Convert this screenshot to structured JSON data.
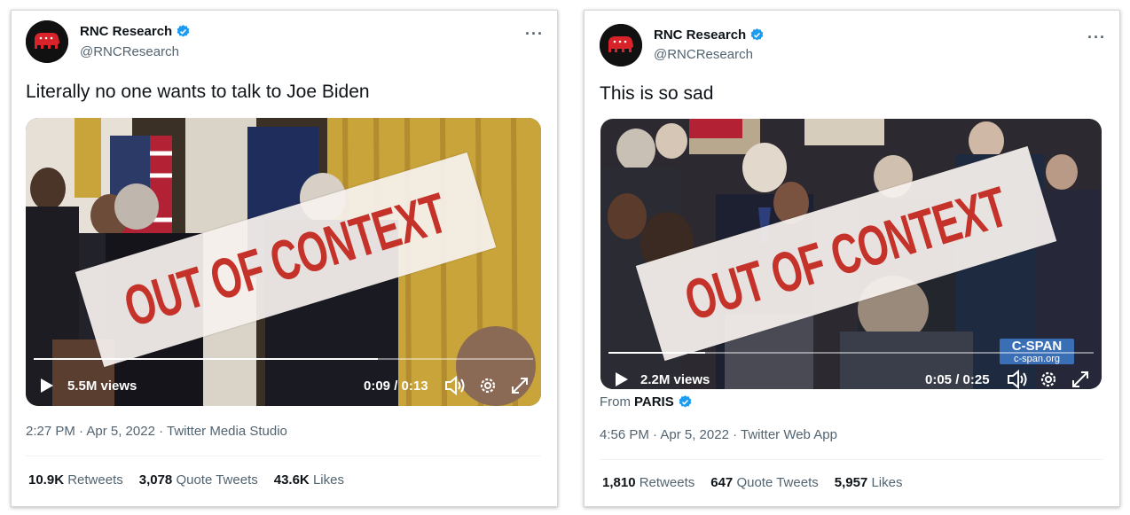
{
  "left": {
    "account": {
      "name": "RNC Research",
      "handle": "@RNCResearch"
    },
    "more_label": "···",
    "text": "Literally no one wants to talk to Joe Biden",
    "video": {
      "views": "5.5M views",
      "time": "0:09 / 0:13",
      "progress": 0.69
    },
    "overlay": "OUT OF CONTEXT",
    "meta": "2:27 PM · Apr 5, 2022 · Twitter Media Studio",
    "stats": {
      "retweets_count": "10.9K",
      "retweets_label": "Retweets",
      "quotes_count": "3,078",
      "quotes_label": "Quote Tweets",
      "likes_count": "43.6K",
      "likes_label": "Likes"
    }
  },
  "right": {
    "account": {
      "name": "RNC Research",
      "handle": "@RNCResearch"
    },
    "more_label": "···",
    "text": "This is so sad",
    "video": {
      "views": "2.2M views",
      "time": "0:05 / 0:25",
      "progress": 0.2
    },
    "overlay": "OUT OF CONTEXT",
    "cspan": {
      "logo": "C-SPAN",
      "url": "c-span.org"
    },
    "from": {
      "label": "From",
      "source": "PARIS"
    },
    "meta": "4:56 PM · Apr 5, 2022 · Twitter Web App",
    "stats": {
      "retweets_count": "1,810",
      "retweets_label": "Retweets",
      "quotes_count": "647",
      "quotes_label": "Quote Tweets",
      "likes_count": "5,957",
      "likes_label": "Likes"
    }
  },
  "icons": [
    "republican-elephant-logo",
    "verified-badge-icon",
    "more-options-icon",
    "play-icon",
    "volume-icon",
    "settings-gear-icon",
    "fullscreen-icon"
  ],
  "colors": {
    "overlay_text": "#c4322a",
    "verified": "#1d9bf0",
    "cspan": "#3a6fb6",
    "avatar_bg": "#111111"
  }
}
